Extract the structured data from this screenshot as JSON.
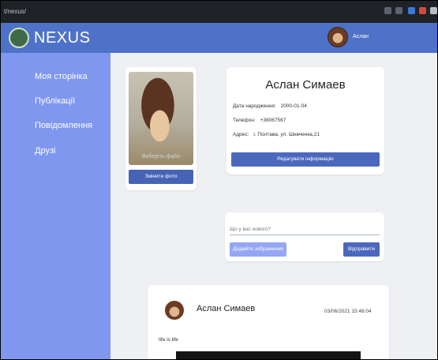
{
  "browser": {
    "url": "t/nexus/"
  },
  "header": {
    "brand": "NEXUS",
    "user_name": "Аслан"
  },
  "sidebar": {
    "items": [
      {
        "label": "Моя сторінка"
      },
      {
        "label": "Публікації"
      },
      {
        "label": "Повідомлення"
      },
      {
        "label": "Друзі"
      }
    ]
  },
  "profile": {
    "choose_file": "Виберіть файл",
    "change_photo": "Змінити фото",
    "name": "Аслан Симаев",
    "birth_label": "Дата народження:",
    "birth_value": "2000-01-04",
    "phone_label": "Телефон:",
    "phone_value": "+38067567",
    "address_label": "Адрес:",
    "address_value": "г. Полтава, ул. Шевченка,21",
    "edit_button": "Редагувати інформацію"
  },
  "composer": {
    "placeholder": "Що у вас нового?",
    "add_image": "Додайте зображення",
    "send": "Відправити"
  },
  "post": {
    "author": "Аслан Симаев",
    "timestamp": "03/06/2021 15:46:04",
    "text": "life is life"
  },
  "colors": {
    "header": "#4f72c9",
    "sidebar": "#7f97ef",
    "button": "#4b68bd",
    "button_light": "#95a7f2"
  }
}
